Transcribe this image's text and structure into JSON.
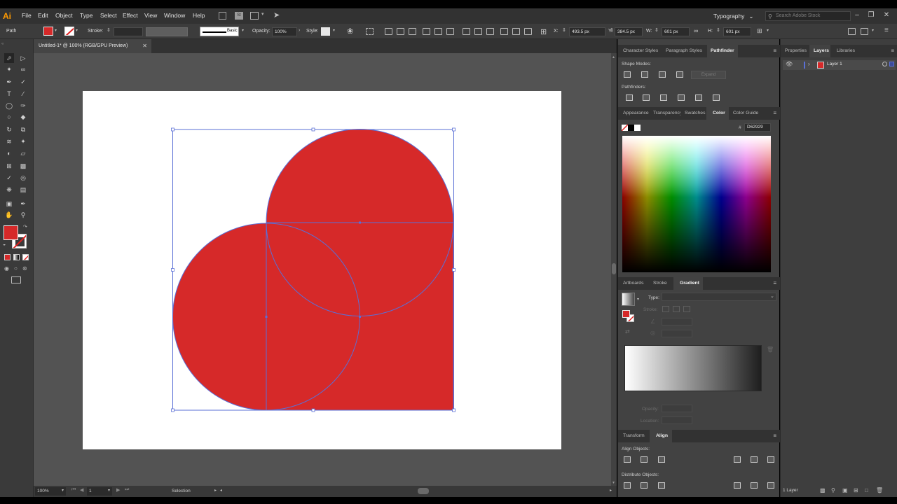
{
  "app": {
    "logo": "Ai",
    "menu": [
      "File",
      "Edit",
      "Object",
      "Type",
      "Select",
      "Effect",
      "View",
      "Window",
      "Help"
    ],
    "workspace": "Typography",
    "stock_search_placeholder": "Search Adobe Stock"
  },
  "control_bar": {
    "selection_type": "Path",
    "stroke_label": "Stroke:",
    "brush_label": "Basic",
    "opacity_label": "Opacity:",
    "opacity_value": "100%",
    "style_label": "Style:",
    "x_label": "X:",
    "x_value": "493.5 px",
    "y_label": "Y:",
    "y_value": "384.5 px",
    "w_label": "W:",
    "w_value": "601 px",
    "h_label": "H:",
    "h_value": "601 px"
  },
  "document": {
    "tab_title": "Untitled-1* @ 100% (RGB/GPU Preview)",
    "fill_color": "#d62929",
    "selection_color": "#5a6fd6"
  },
  "status_bar": {
    "zoom": "100%",
    "artboard_number": "1",
    "current_tool": "Selection"
  },
  "panels": {
    "top_tabs": [
      "Character Styles",
      "Paragraph Styles",
      "Pathfinder"
    ],
    "active_top_tab": "Pathfinder",
    "shape_modes_label": "Shape Modes:",
    "expand_label": "Expand",
    "pathfinders_label": "Pathfinders:",
    "color_tabs": [
      "Appearance",
      "Transparency",
      "Swatches",
      "Color",
      "Color Guide"
    ],
    "hex_prefix": "#",
    "hex_value": "D62929",
    "gradient_tabs": [
      "Artboards",
      "Stroke",
      "Gradient"
    ],
    "gradient_type_label": "Type:",
    "gradient_stroke_label": "Stroke:",
    "opacity_label": "Opacity:",
    "location_label": "Location:",
    "align_tabs": [
      "Transform",
      "Align"
    ],
    "align_objects_label": "Align Objects:",
    "distribute_objects_label": "Distribute Objects:"
  },
  "layers_panel": {
    "tabs": [
      "Properties",
      "Layers",
      "Libraries"
    ],
    "active_tab": "Layers",
    "layer_name": "Layer 1",
    "layer_count": "1 Layer"
  }
}
